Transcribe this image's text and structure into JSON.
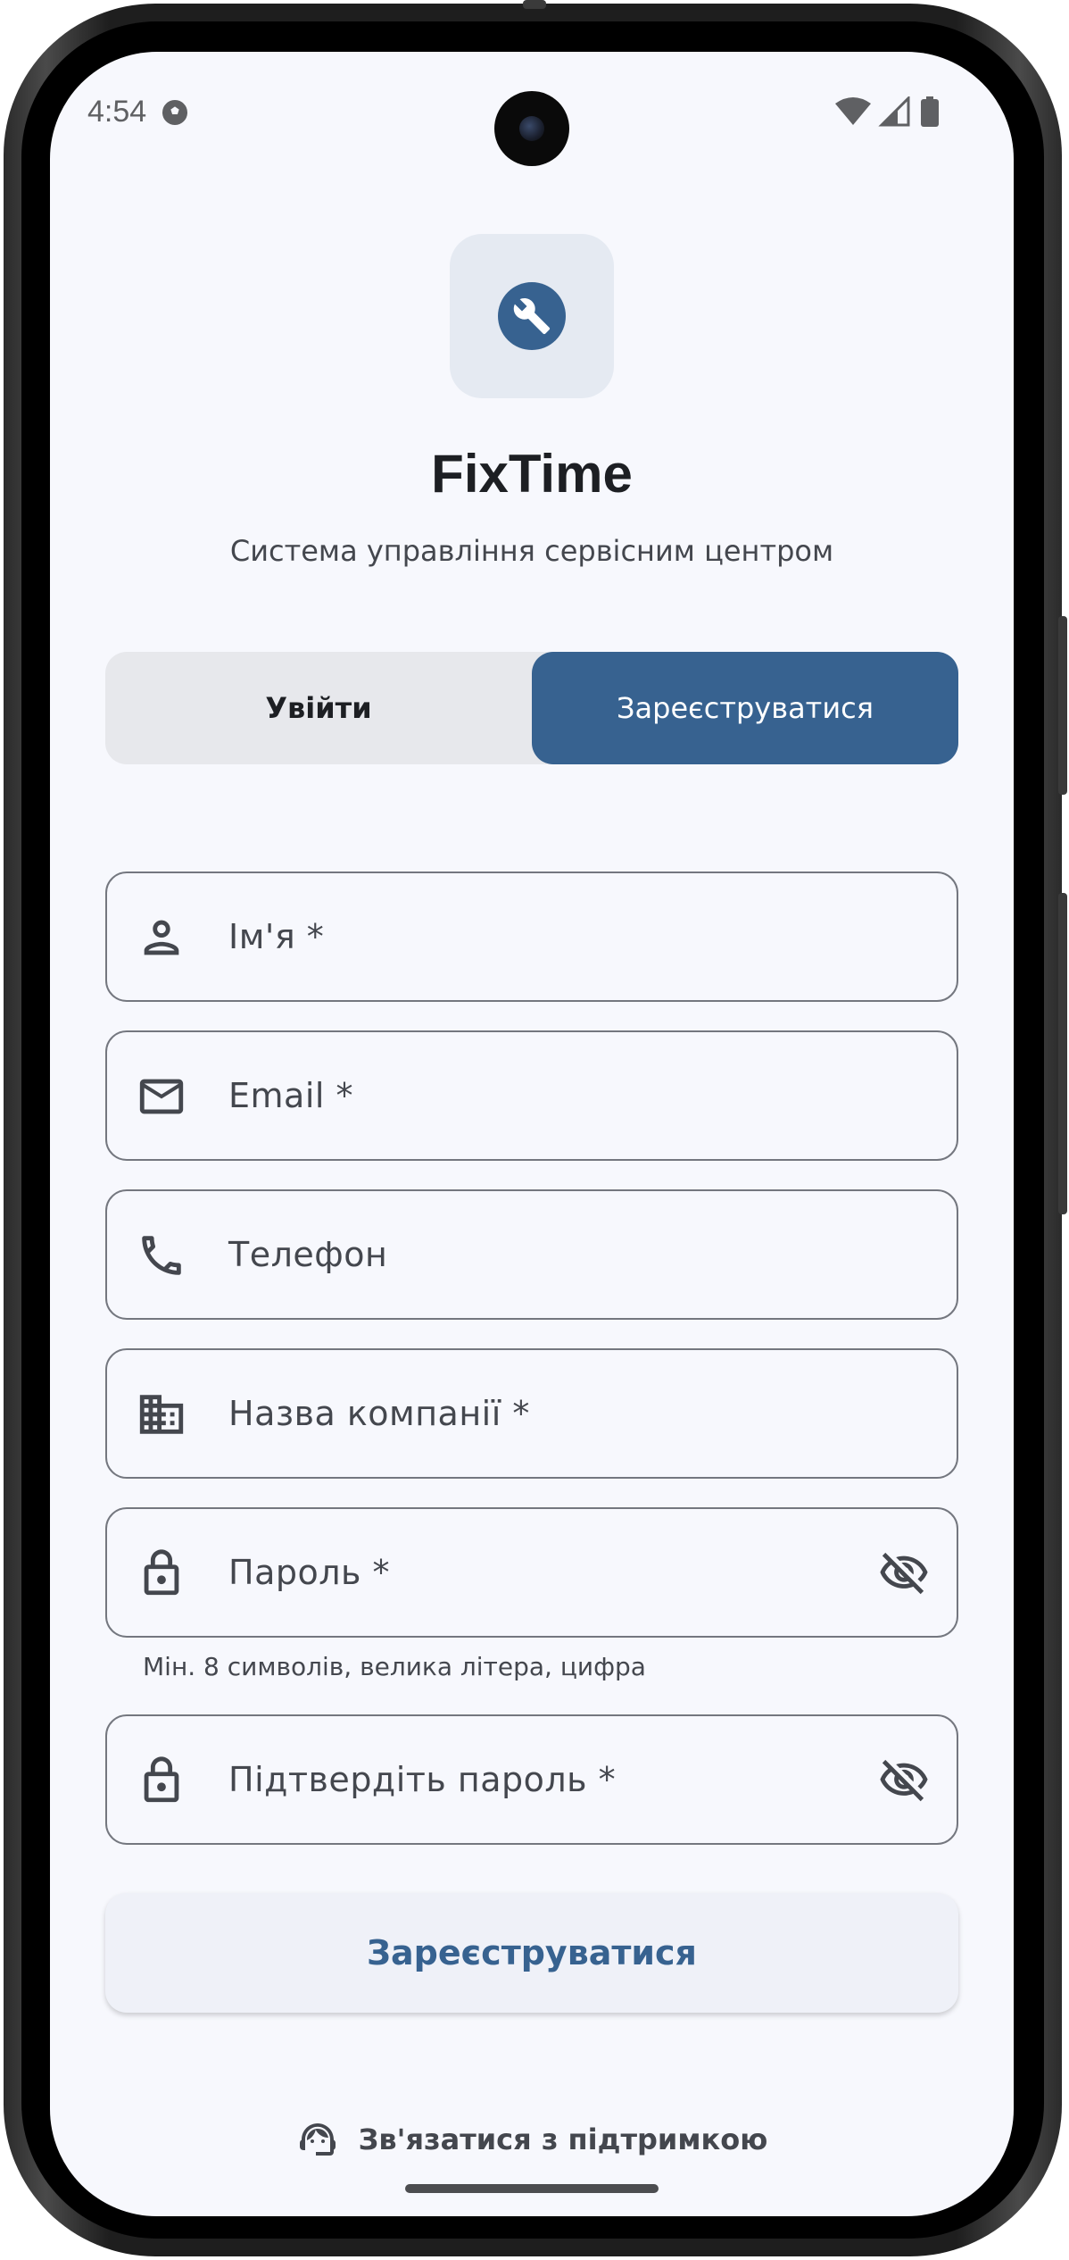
{
  "status_bar": {
    "time": "4:54",
    "ball_icon": "soccer-ball-icon",
    "icons": [
      "wifi-icon",
      "signal-icon",
      "battery-icon"
    ]
  },
  "app": {
    "logo_icon": "wrench-icon",
    "title": "FixTime",
    "subtitle": "Система управління сервісним центром",
    "accent_color": "#376290"
  },
  "tabs": {
    "login": "Увійти",
    "register": "Зареєструватися",
    "active": "register"
  },
  "form": {
    "fields": [
      {
        "label": "Ім'я *",
        "icon": "person-icon"
      },
      {
        "label": "Email *",
        "icon": "mail-icon"
      },
      {
        "label": "Телефон",
        "icon": "phone-icon"
      },
      {
        "label": "Назва компанії *",
        "icon": "building-icon"
      },
      {
        "label": "Пароль *",
        "icon": "lock-icon",
        "toggle_icon": "eye-off-icon"
      },
      {
        "label": "Підтвердіть пароль *",
        "icon": "lock-icon",
        "toggle_icon": "eye-off-icon"
      }
    ],
    "password_helper": "Мін. 8 символів, велика літера, цифра",
    "submit_label": "Зареєструватися"
  },
  "support": {
    "icon": "support-agent-icon",
    "label": "Зв'язатися з підтримкою"
  }
}
